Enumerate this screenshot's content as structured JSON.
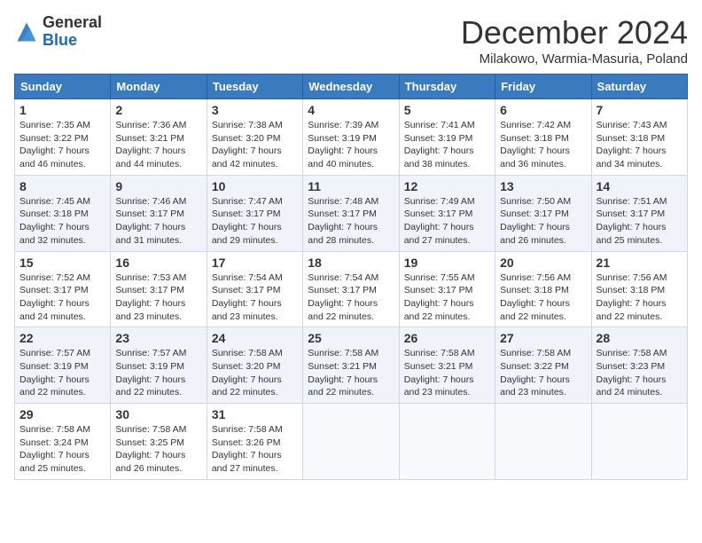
{
  "header": {
    "logo_general": "General",
    "logo_blue": "Blue",
    "month_title": "December 2024",
    "subtitle": "Milakowo, Warmia-Masuria, Poland"
  },
  "days_of_week": [
    "Sunday",
    "Monday",
    "Tuesday",
    "Wednesday",
    "Thursday",
    "Friday",
    "Saturday"
  ],
  "weeks": [
    [
      {
        "day": "1",
        "sunrise": "7:35 AM",
        "sunset": "3:22 PM",
        "daylight": "7 hours and 46 minutes."
      },
      {
        "day": "2",
        "sunrise": "7:36 AM",
        "sunset": "3:21 PM",
        "daylight": "7 hours and 44 minutes."
      },
      {
        "day": "3",
        "sunrise": "7:38 AM",
        "sunset": "3:20 PM",
        "daylight": "7 hours and 42 minutes."
      },
      {
        "day": "4",
        "sunrise": "7:39 AM",
        "sunset": "3:19 PM",
        "daylight": "7 hours and 40 minutes."
      },
      {
        "day": "5",
        "sunrise": "7:41 AM",
        "sunset": "3:19 PM",
        "daylight": "7 hours and 38 minutes."
      },
      {
        "day": "6",
        "sunrise": "7:42 AM",
        "sunset": "3:18 PM",
        "daylight": "7 hours and 36 minutes."
      },
      {
        "day": "7",
        "sunrise": "7:43 AM",
        "sunset": "3:18 PM",
        "daylight": "7 hours and 34 minutes."
      }
    ],
    [
      {
        "day": "8",
        "sunrise": "7:45 AM",
        "sunset": "3:18 PM",
        "daylight": "7 hours and 32 minutes."
      },
      {
        "day": "9",
        "sunrise": "7:46 AM",
        "sunset": "3:17 PM",
        "daylight": "7 hours and 31 minutes."
      },
      {
        "day": "10",
        "sunrise": "7:47 AM",
        "sunset": "3:17 PM",
        "daylight": "7 hours and 29 minutes."
      },
      {
        "day": "11",
        "sunrise": "7:48 AM",
        "sunset": "3:17 PM",
        "daylight": "7 hours and 28 minutes."
      },
      {
        "day": "12",
        "sunrise": "7:49 AM",
        "sunset": "3:17 PM",
        "daylight": "7 hours and 27 minutes."
      },
      {
        "day": "13",
        "sunrise": "7:50 AM",
        "sunset": "3:17 PM",
        "daylight": "7 hours and 26 minutes."
      },
      {
        "day": "14",
        "sunrise": "7:51 AM",
        "sunset": "3:17 PM",
        "daylight": "7 hours and 25 minutes."
      }
    ],
    [
      {
        "day": "15",
        "sunrise": "7:52 AM",
        "sunset": "3:17 PM",
        "daylight": "7 hours and 24 minutes."
      },
      {
        "day": "16",
        "sunrise": "7:53 AM",
        "sunset": "3:17 PM",
        "daylight": "7 hours and 23 minutes."
      },
      {
        "day": "17",
        "sunrise": "7:54 AM",
        "sunset": "3:17 PM",
        "daylight": "7 hours and 23 minutes."
      },
      {
        "day": "18",
        "sunrise": "7:54 AM",
        "sunset": "3:17 PM",
        "daylight": "7 hours and 22 minutes."
      },
      {
        "day": "19",
        "sunrise": "7:55 AM",
        "sunset": "3:17 PM",
        "daylight": "7 hours and 22 minutes."
      },
      {
        "day": "20",
        "sunrise": "7:56 AM",
        "sunset": "3:18 PM",
        "daylight": "7 hours and 22 minutes."
      },
      {
        "day": "21",
        "sunrise": "7:56 AM",
        "sunset": "3:18 PM",
        "daylight": "7 hours and 22 minutes."
      }
    ],
    [
      {
        "day": "22",
        "sunrise": "7:57 AM",
        "sunset": "3:19 PM",
        "daylight": "7 hours and 22 minutes."
      },
      {
        "day": "23",
        "sunrise": "7:57 AM",
        "sunset": "3:19 PM",
        "daylight": "7 hours and 22 minutes."
      },
      {
        "day": "24",
        "sunrise": "7:58 AM",
        "sunset": "3:20 PM",
        "daylight": "7 hours and 22 minutes."
      },
      {
        "day": "25",
        "sunrise": "7:58 AM",
        "sunset": "3:21 PM",
        "daylight": "7 hours and 22 minutes."
      },
      {
        "day": "26",
        "sunrise": "7:58 AM",
        "sunset": "3:21 PM",
        "daylight": "7 hours and 23 minutes."
      },
      {
        "day": "27",
        "sunrise": "7:58 AM",
        "sunset": "3:22 PM",
        "daylight": "7 hours and 23 minutes."
      },
      {
        "day": "28",
        "sunrise": "7:58 AM",
        "sunset": "3:23 PM",
        "daylight": "7 hours and 24 minutes."
      }
    ],
    [
      {
        "day": "29",
        "sunrise": "7:58 AM",
        "sunset": "3:24 PM",
        "daylight": "7 hours and 25 minutes."
      },
      {
        "day": "30",
        "sunrise": "7:58 AM",
        "sunset": "3:25 PM",
        "daylight": "7 hours and 26 minutes."
      },
      {
        "day": "31",
        "sunrise": "7:58 AM",
        "sunset": "3:26 PM",
        "daylight": "7 hours and 27 minutes."
      },
      null,
      null,
      null,
      null
    ]
  ]
}
